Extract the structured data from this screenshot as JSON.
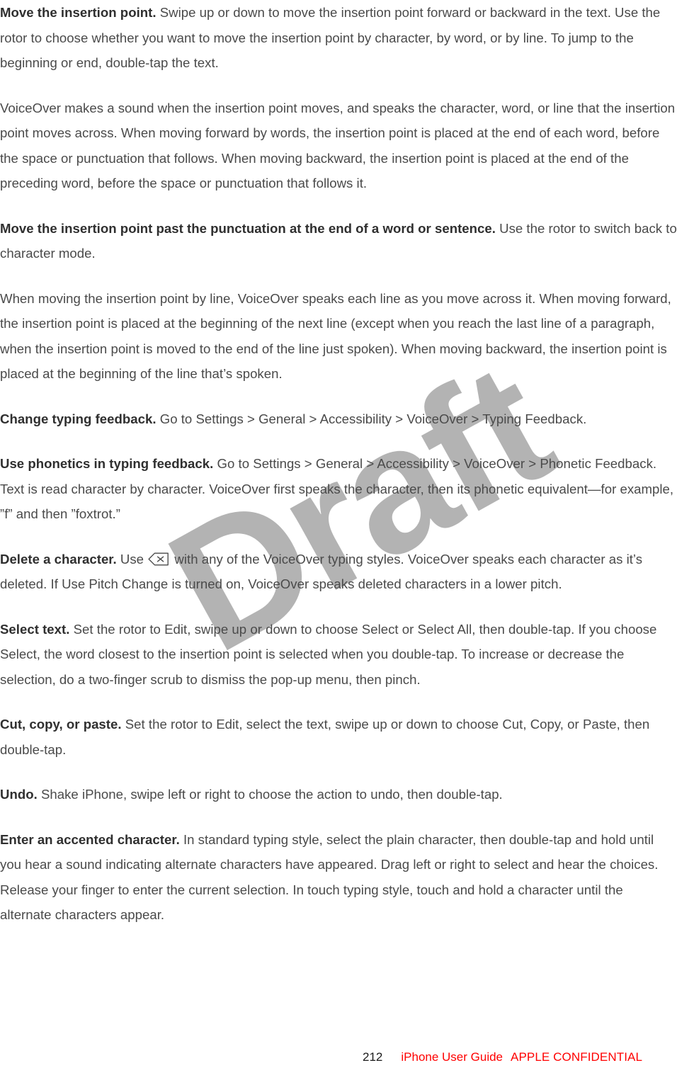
{
  "document": {
    "title": "iPhone User Guide",
    "watermark": "Draft",
    "watermark_color": "#b3b3b3"
  },
  "paragraphs": [
    {
      "id": "move-insertion-point",
      "lead": "Move the insertion point.",
      "body": " Swipe up or down to move the insertion point forward or backward in the text. Use the rotor to choose whether you want to move the insertion point by character, by word, or by line. To jump to the beginning or end, double-tap the text."
    },
    {
      "id": "voiceover-sound",
      "lead": "",
      "body": "VoiceOver makes a sound when the insertion point moves, and speaks the character, word, or line that the insertion point moves across. When moving forward by words, the insertion point is placed at the end of each word, before the space or punctuation that follows. When moving backward, the insertion point is placed at the end of the preceding word, before the space or punctuation that follows it."
    },
    {
      "id": "move-past-punctuation",
      "lead": "Move the insertion point past the punctuation at the end of a word or sentence.",
      "body": " Use the rotor to switch back to character mode."
    },
    {
      "id": "move-by-line",
      "lead": "",
      "body": "When moving the insertion point by line, VoiceOver speaks each line as you move across it. When moving forward, the insertion point is placed at the beginning of the next line (except when you reach the last line of a paragraph, when the insertion point is moved to the end of the line just spoken). When moving backward, the insertion point is placed at the beginning of the line that’s spoken."
    },
    {
      "id": "change-typing-feedback",
      "lead": "Change typing feedback.",
      "body": " Go to Settings > General > Accessibility > VoiceOver > Typing Feedback."
    },
    {
      "id": "use-phonetics",
      "lead": "Use phonetics in typing feedback.",
      "body": " Go to Settings > General > Accessibility > VoiceOver > Phonetic Feedback. Text is read character by character. VoiceOver first speaks the character, then its phonetic equivalent—for example, ”f” and then ”foxtrot.”"
    },
    {
      "id": "delete-a-character",
      "lead": "Delete a character.",
      "body_before_icon": " Use ",
      "icon": "delete-key-icon",
      "body_after_icon": " with any of the VoiceOver typing styles. VoiceOver speaks each character as it’s deleted. If Use Pitch Change is turned on, VoiceOver speaks deleted characters in a lower pitch."
    },
    {
      "id": "select-text",
      "lead": "Select text.",
      "body": " Set the rotor to Edit, swipe up or down to choose Select or Select All, then double-tap. If you choose Select, the word closest to the insertion point is selected when you double-tap. To increase or decrease the selection, do a two-finger scrub to dismiss the pop-up menu, then pinch."
    },
    {
      "id": "cut-copy-paste",
      "lead": "Cut, copy, or paste.",
      "body": " Set the rotor to Edit, select the text, swipe up or down to choose Cut, Copy, or Paste, then double-tap."
    },
    {
      "id": "undo",
      "lead": "Undo.",
      "body": " Shake iPhone, swipe left or right to choose the action to undo, then double-tap."
    },
    {
      "id": "enter-accented-character",
      "lead": "Enter an accented character.",
      "body": " In standard typing style, select the plain character, then double-tap and hold until you hear a sound indicating alternate characters have appeared. Drag left or right to select and hear the choices. Release your finger to enter the current selection. In touch typing style, touch and hold a character until the alternate characters appear."
    }
  ],
  "footer": {
    "page_number": "212",
    "guide_title": "iPhone User Guide",
    "confidential": "APPLE CONFIDENTIAL",
    "accent_color": "#ff0000"
  }
}
